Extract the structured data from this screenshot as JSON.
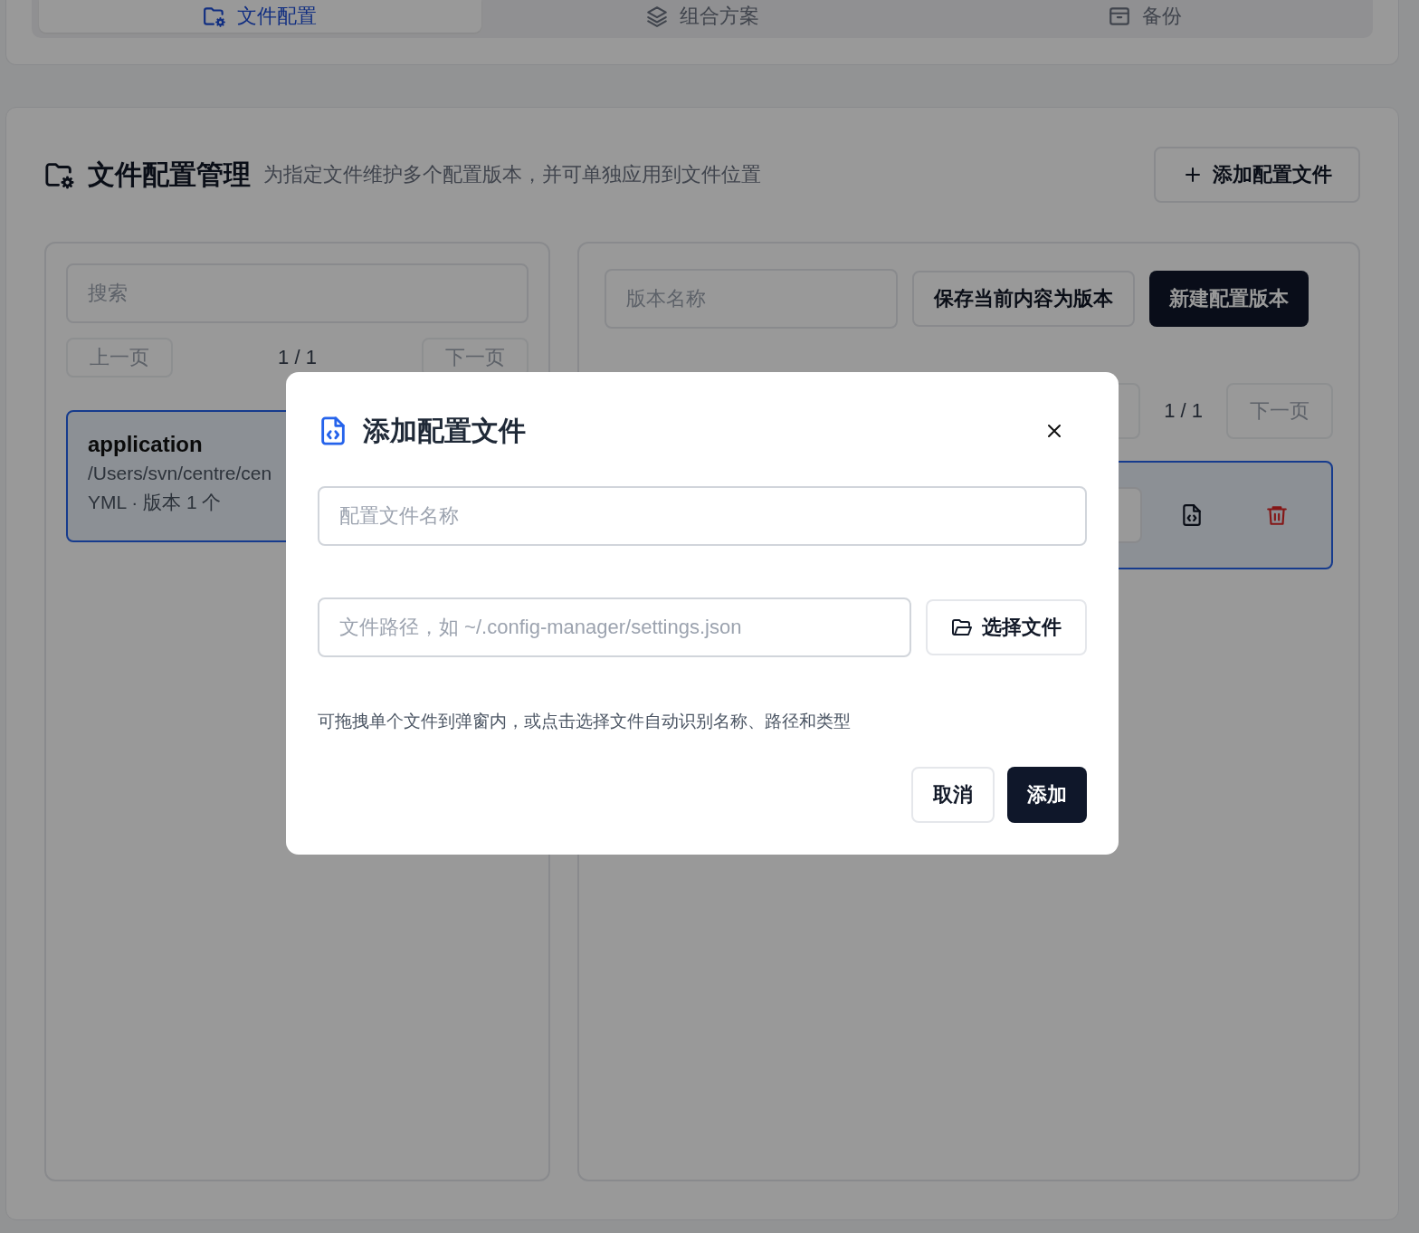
{
  "tabs": [
    {
      "label": "文件配置",
      "selected": true
    },
    {
      "label": "组合方案",
      "selected": false
    },
    {
      "label": "备份",
      "selected": false
    }
  ],
  "section": {
    "title": "文件配置管理",
    "subtitle": "为指定文件维护多个配置版本，并可单独应用到文件位置",
    "add_button": "添加配置文件"
  },
  "file_list": {
    "search": {
      "placeholder": "搜索"
    },
    "pagination": {
      "prev": "上一页",
      "page": "1 / 1",
      "next": "下一页"
    },
    "items": [
      {
        "name": "application",
        "path": "/Users/svn/centre/cen",
        "meta": "YML · 版本 1 个",
        "selected": true
      }
    ]
  },
  "versions": {
    "name_field": {
      "placeholder": "版本名称"
    },
    "save_button": "保存当前内容为版本",
    "new_button": "新建配置版本",
    "pagination": {
      "page": "1 / 1",
      "next": "下一页"
    },
    "items": [
      {
        "selected": true
      }
    ]
  },
  "dialog": {
    "title": "添加配置文件",
    "name_field": {
      "placeholder": "配置文件名称"
    },
    "path_field": {
      "placeholder": "文件路径，如 ~/.config-manager/settings.json"
    },
    "choose_button": "选择文件",
    "hint": "可拖拽单个文件到弹窗内，或点击选择文件自动识别名称、路径和类型",
    "cancel_button": "取消",
    "confirm_button": "添加"
  }
}
